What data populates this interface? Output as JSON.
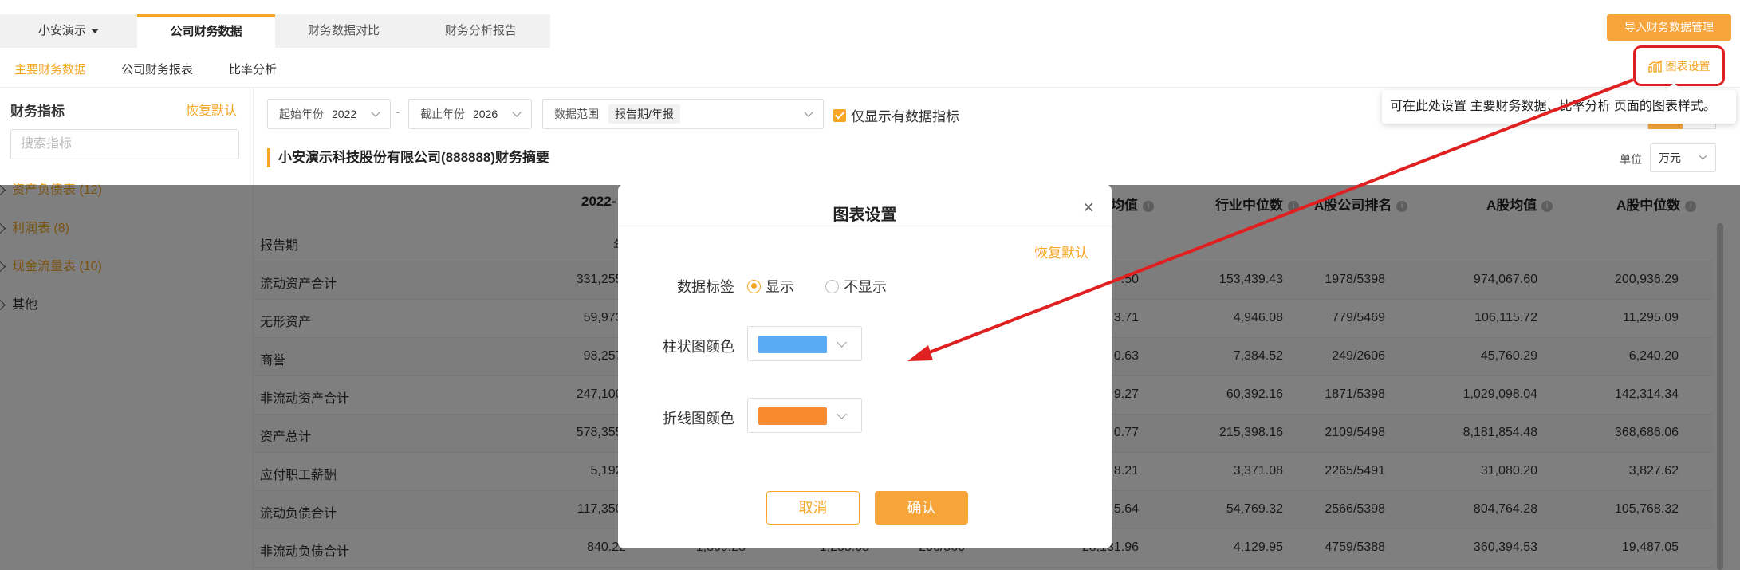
{
  "header": {
    "company_select": "小安演示",
    "tabs": [
      "公司财务数据",
      "财务数据对比",
      "财务分析报告"
    ],
    "import_button": "导入财务数据管理"
  },
  "subtabs": [
    "主要财务数据",
    "公司财务报表",
    "比率分析"
  ],
  "chart_settings_button": "图表设置",
  "tooltip": "可在此处设置 主要财务数据、比率分析 页面的图表样式。",
  "sidebar": {
    "title": "财务指标",
    "reset": "恢复默认",
    "search_placeholder": "搜索指标",
    "items": [
      "资产负债表 (12)",
      "利润表 (8)",
      "现金流量表 (10)",
      "其他"
    ]
  },
  "filters": {
    "start_year_label": "起始年份",
    "start_year": "2022",
    "separator": "-",
    "end_year_label": "截止年份",
    "end_year": "2026",
    "range_label": "数据范围",
    "range_tag": "报告期/年报",
    "only_data_label": "仅显示有数据指标"
  },
  "summary_title": "小安演示科技股份有限公司(888888)财务摘要",
  "unit": {
    "label": "单位",
    "value": "万元"
  },
  "table": {
    "headers": [
      "2022-",
      "均值",
      "行业中位数",
      "A股公司排名",
      "A股均值",
      "A股中位数"
    ],
    "rows": [
      {
        "label": "报告期",
        "c1": "年",
        "c5": "",
        "c6": "",
        "c7": "",
        "c8": "",
        "c9": ""
      },
      {
        "label": "流动资产合计",
        "c1": "331,255.",
        "c5": ".50",
        "c6": "153,439.43",
        "c7": "1978/5398",
        "c8": "974,067.60",
        "c9": "200,936.29"
      },
      {
        "label": "无形资产",
        "c1": "59,973.",
        "c5": "3.71",
        "c6": "4,946.08",
        "c7": "779/5469",
        "c8": "106,115.72",
        "c9": "11,295.09"
      },
      {
        "label": "商誉",
        "c1": "98,257.",
        "c5": "0.63",
        "c6": "7,384.52",
        "c7": "249/2606",
        "c8": "45,760.29",
        "c9": "6,240.20"
      },
      {
        "label": "非流动资产合计",
        "c1": "247,100.",
        "c5": "9.27",
        "c6": "60,392.16",
        "c7": "1871/5398",
        "c8": "1,029,098.04",
        "c9": "142,314.34"
      },
      {
        "label": "资产总计",
        "c1": "578,355.",
        "c5": "0.77",
        "c6": "215,398.16",
        "c7": "2109/5498",
        "c8": "8,181,854.48",
        "c9": "368,686.06"
      },
      {
        "label": "应付职工薪酬",
        "c1": "5,192.",
        "c5": "8.21",
        "c6": "3,371.08",
        "c7": "2265/5491",
        "c8": "31,080.20",
        "c9": "3,827.62"
      },
      {
        "label": "流动负债合计",
        "c1": "117,350.",
        "c5": "5.64",
        "c6": "54,769.32",
        "c7": "2566/5398",
        "c8": "804,764.28",
        "c9": "105,768.32"
      },
      {
        "label": "非流动负债合计",
        "c1": "840.22",
        "c2": "1,309.25",
        "c3": "1,255.05",
        "c4": "206/560",
        "c5": "28,131.96",
        "c6": "4,129.95",
        "c7": "4759/5388",
        "c8": "360,394.53",
        "c9": "19,487.05"
      }
    ]
  },
  "dialog": {
    "title": "图表设置",
    "close": "×",
    "reset": "恢复默认",
    "data_label": "数据标签",
    "show": "显示",
    "hide": "不显示",
    "bar_color_label": "柱状图颜色",
    "bar_color": "#5aabf5",
    "line_color_label": "折线图颜色",
    "line_color": "#fb8a2e",
    "cancel": "取消",
    "confirm": "确认"
  },
  "accent_color": "#f5a623",
  "annotation_color": "#e02020"
}
